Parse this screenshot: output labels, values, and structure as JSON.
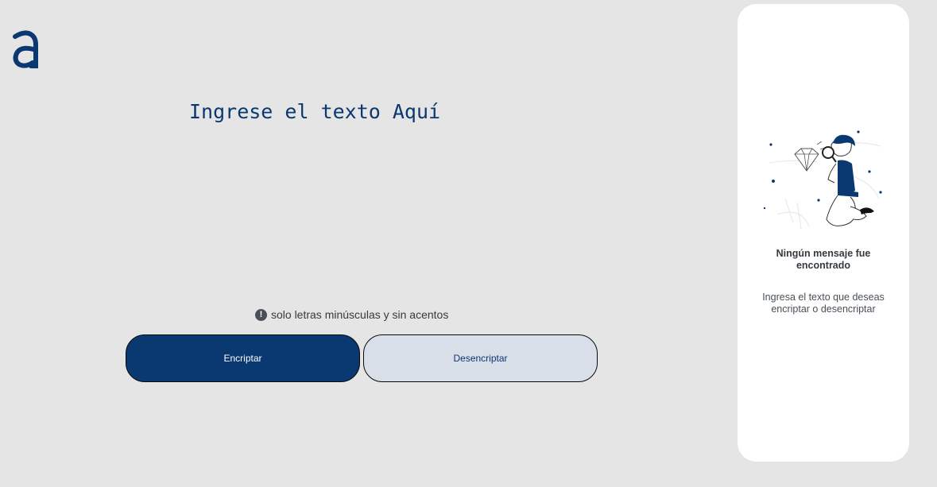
{
  "brand": {
    "logo_icon": "alura-logo-icon",
    "color": "#0a3871"
  },
  "input": {
    "placeholder": "Ingrese el texto Aquí",
    "value": ""
  },
  "hint": {
    "icon": "exclamation-circle-icon",
    "text": "solo letras minúsculas y sin acentos"
  },
  "buttons": {
    "encrypt_label": "Encriptar",
    "decrypt_label": "Desencriptar"
  },
  "output_panel": {
    "illustration": "person-magnifying-glass-diamond-illustration",
    "title": "Ningún mensaje fue encontrado",
    "description": "Ingresa el texto que deseas encriptar o desencriptar"
  },
  "colors": {
    "background": "#e5e5e5",
    "primary": "#0a3871",
    "secondary_button": "#d8dfe8",
    "panel": "#ffffff"
  }
}
